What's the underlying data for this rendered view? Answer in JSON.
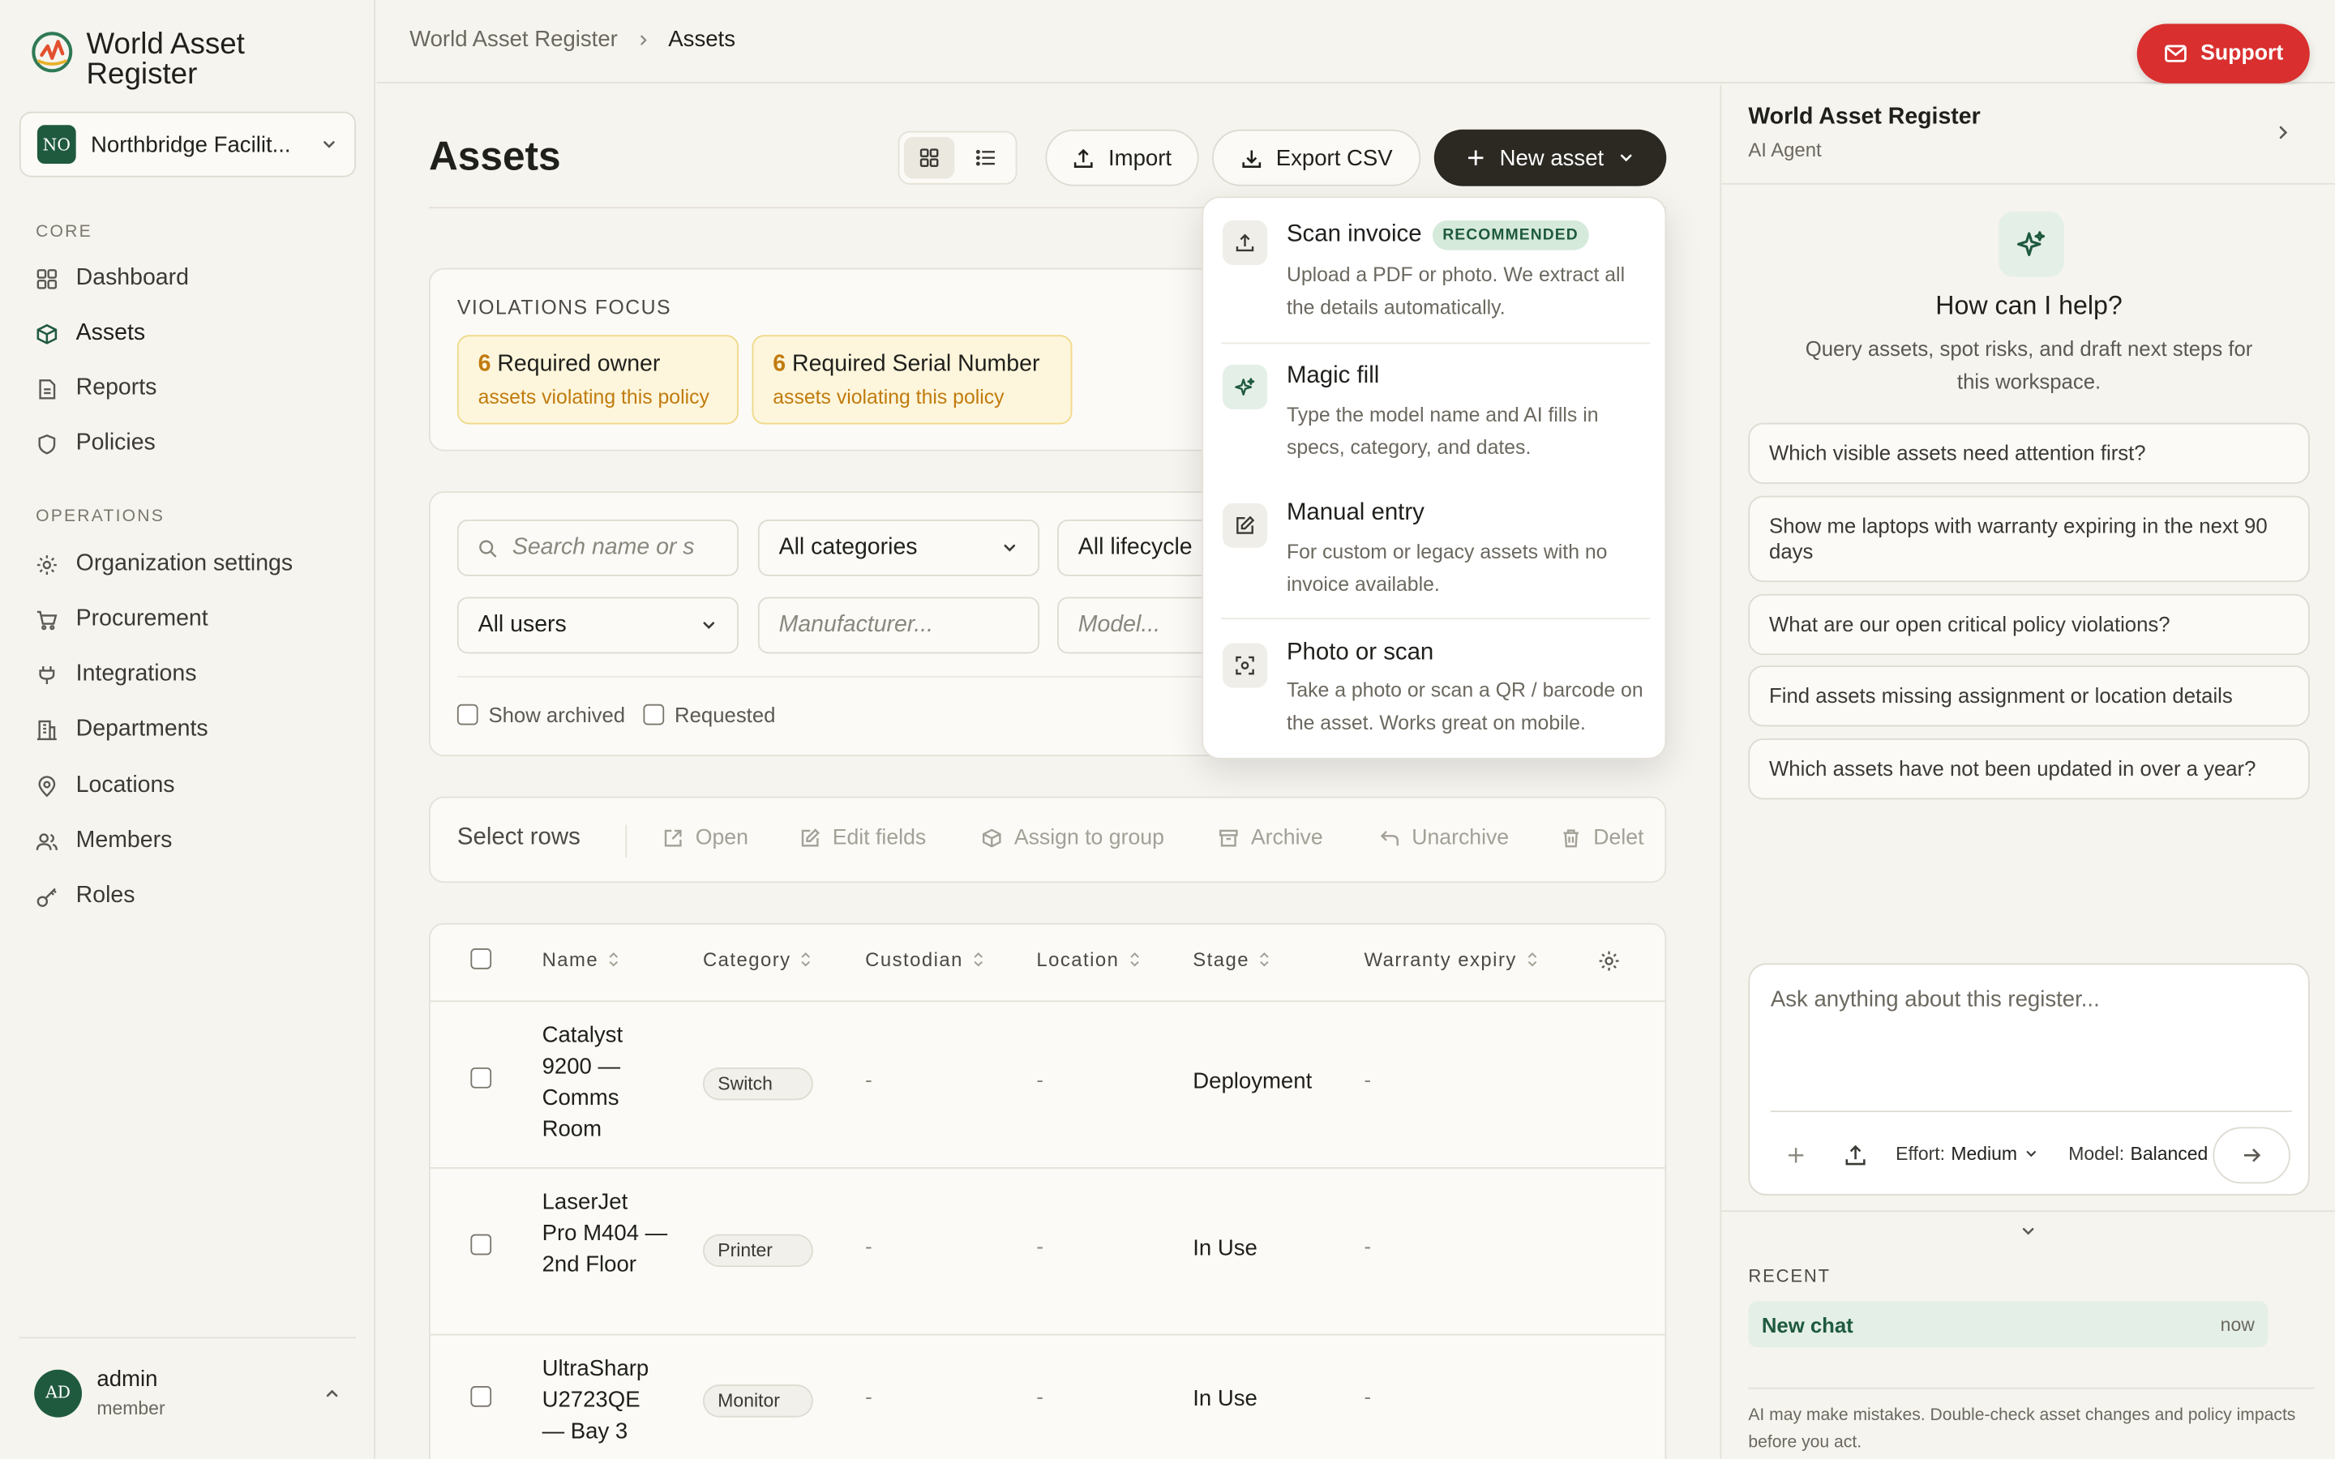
{
  "app": {
    "name": "World Asset Register",
    "org": {
      "initials": "NO",
      "name": "Northbridge Facilit..."
    }
  },
  "sidebar": {
    "sections": [
      {
        "label": "CORE",
        "items": [
          {
            "label": "Dashboard",
            "icon": "dashboard-icon"
          },
          {
            "label": "Assets",
            "icon": "box-icon",
            "active": true
          },
          {
            "label": "Reports",
            "icon": "document-icon"
          },
          {
            "label": "Policies",
            "icon": "shield-icon"
          }
        ]
      },
      {
        "label": "OPERATIONS",
        "items": [
          {
            "label": "Organization settings",
            "icon": "gear-icon"
          },
          {
            "label": "Procurement",
            "icon": "cart-icon"
          },
          {
            "label": "Integrations",
            "icon": "plug-icon"
          },
          {
            "label": "Departments",
            "icon": "building-icon"
          },
          {
            "label": "Locations",
            "icon": "pin-icon"
          },
          {
            "label": "Members",
            "icon": "users-icon"
          },
          {
            "label": "Roles",
            "icon": "key-icon"
          }
        ]
      }
    ],
    "user": {
      "initials": "AD",
      "name": "admin",
      "role": "member"
    }
  },
  "topbar": {
    "breadcrumbs": [
      "World Asset Register",
      "Assets"
    ],
    "support_label": "Support"
  },
  "main": {
    "title": "Assets",
    "actions": {
      "import": "Import",
      "export": "Export CSV",
      "new_asset": "New asset"
    },
    "violations": {
      "title": "VIOLATIONS FOCUS",
      "items": [
        {
          "count": "6",
          "policy": "Required owner",
          "subtitle": "assets violating this policy"
        },
        {
          "count": "6",
          "policy": "Required Serial Number",
          "subtitle": "assets violating this policy"
        }
      ]
    },
    "filters": {
      "search_placeholder": "Search name or s",
      "category": "All categories",
      "lifecycle": "All lifecycle",
      "users": "All users",
      "manufacturer_placeholder": "Manufacturer...",
      "model_placeholder": "Model...",
      "show_archived": "Show archived",
      "requested": "Requested"
    },
    "bulk": {
      "label": "Select rows",
      "actions": [
        "Open",
        "Edit fields",
        "Assign to group",
        "Archive",
        "Unarchive",
        "Delet"
      ]
    },
    "table": {
      "columns": [
        "Name",
        "Category",
        "Custodian",
        "Location",
        "Stage",
        "Warranty expiry"
      ],
      "rows": [
        {
          "name": "Catalyst 9200 — Comms Room",
          "category": "Switch",
          "custodian": "-",
          "location": "-",
          "stage": "Deployment",
          "warranty": "-"
        },
        {
          "name": "LaserJet Pro M404 — 2nd Floor",
          "category": "Printer",
          "custodian": "-",
          "location": "-",
          "stage": "In Use",
          "warranty": "-"
        },
        {
          "name": "UltraSharp U2723QE — Bay 3",
          "category": "Monitor",
          "custodian": "-",
          "location": "-",
          "stage": "In Use",
          "warranty": "-"
        }
      ]
    }
  },
  "new_asset_menu": {
    "items": [
      {
        "title": "Scan invoice",
        "badge": "RECOMMENDED",
        "desc": "Upload a PDF or photo. We extract all the details automatically.",
        "icon": "upload-icon"
      },
      {
        "title": "Magic fill",
        "desc": "Type the model name and AI fills in specs, category, and dates.",
        "icon": "sparkle-icon"
      },
      {
        "title": "Manual entry",
        "desc": "For custom or legacy assets with no invoice available.",
        "icon": "edit-icon"
      },
      {
        "title": "Photo or scan",
        "desc": "Take a photo or scan a QR / barcode on the asset. Works great on mobile.",
        "icon": "scan-icon"
      }
    ]
  },
  "ai_panel": {
    "title": "World Asset Register",
    "subtitle": "AI Agent",
    "help_title": "How can I help?",
    "help_sub": "Query assets, spot risks, and draft next steps for this workspace.",
    "suggestions": [
      "Which visible assets need attention first?",
      "Show me laptops with warranty expiring in the next 90 days",
      "What are our open critical policy violations?",
      "Find assets missing assignment or location details",
      "Which assets have not been updated in over a year?"
    ],
    "input_placeholder": "Ask anything about this register...",
    "effort_label": "Effort:",
    "effort_value": "Medium",
    "model_label": "Model:",
    "model_value": "Balanced",
    "recent_label": "RECENT",
    "recent": [
      {
        "title": "New chat",
        "time": "now"
      }
    ],
    "disclaimer": "AI may make mistakes. Double-check asset changes and policy impacts before you act."
  },
  "colors": {
    "brand_green": "#1f5a3e",
    "support_red": "#d92f2f",
    "warning_amber": "#c17b0e",
    "dark_button": "#2b2922"
  }
}
